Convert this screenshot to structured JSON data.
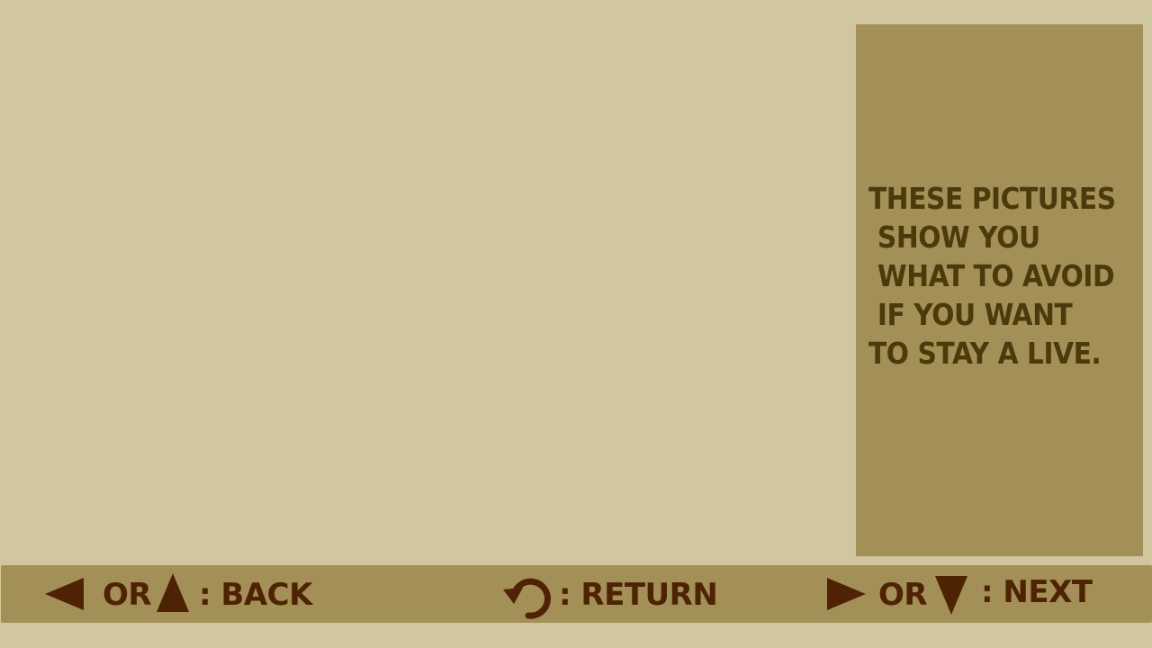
{
  "info_panel": {
    "text": "These pictures\n show you\n what to avoid\n if you want\nto stay a live."
  },
  "controls": {
    "back": {
      "or_label": "or",
      "label": ": back",
      "icons": [
        "left-arrow-icon",
        "up-arrow-icon"
      ]
    },
    "return": {
      "label": ": return",
      "icon": "return-icon"
    },
    "next": {
      "or_label": "or",
      "label": ": next",
      "icons": [
        "right-arrow-icon",
        "down-arrow-icon"
      ]
    }
  },
  "colors": {
    "background": "#d0c79e",
    "panel": "#a39056",
    "panel_text": "#4a3a0c",
    "control_text": "#4e2304"
  }
}
